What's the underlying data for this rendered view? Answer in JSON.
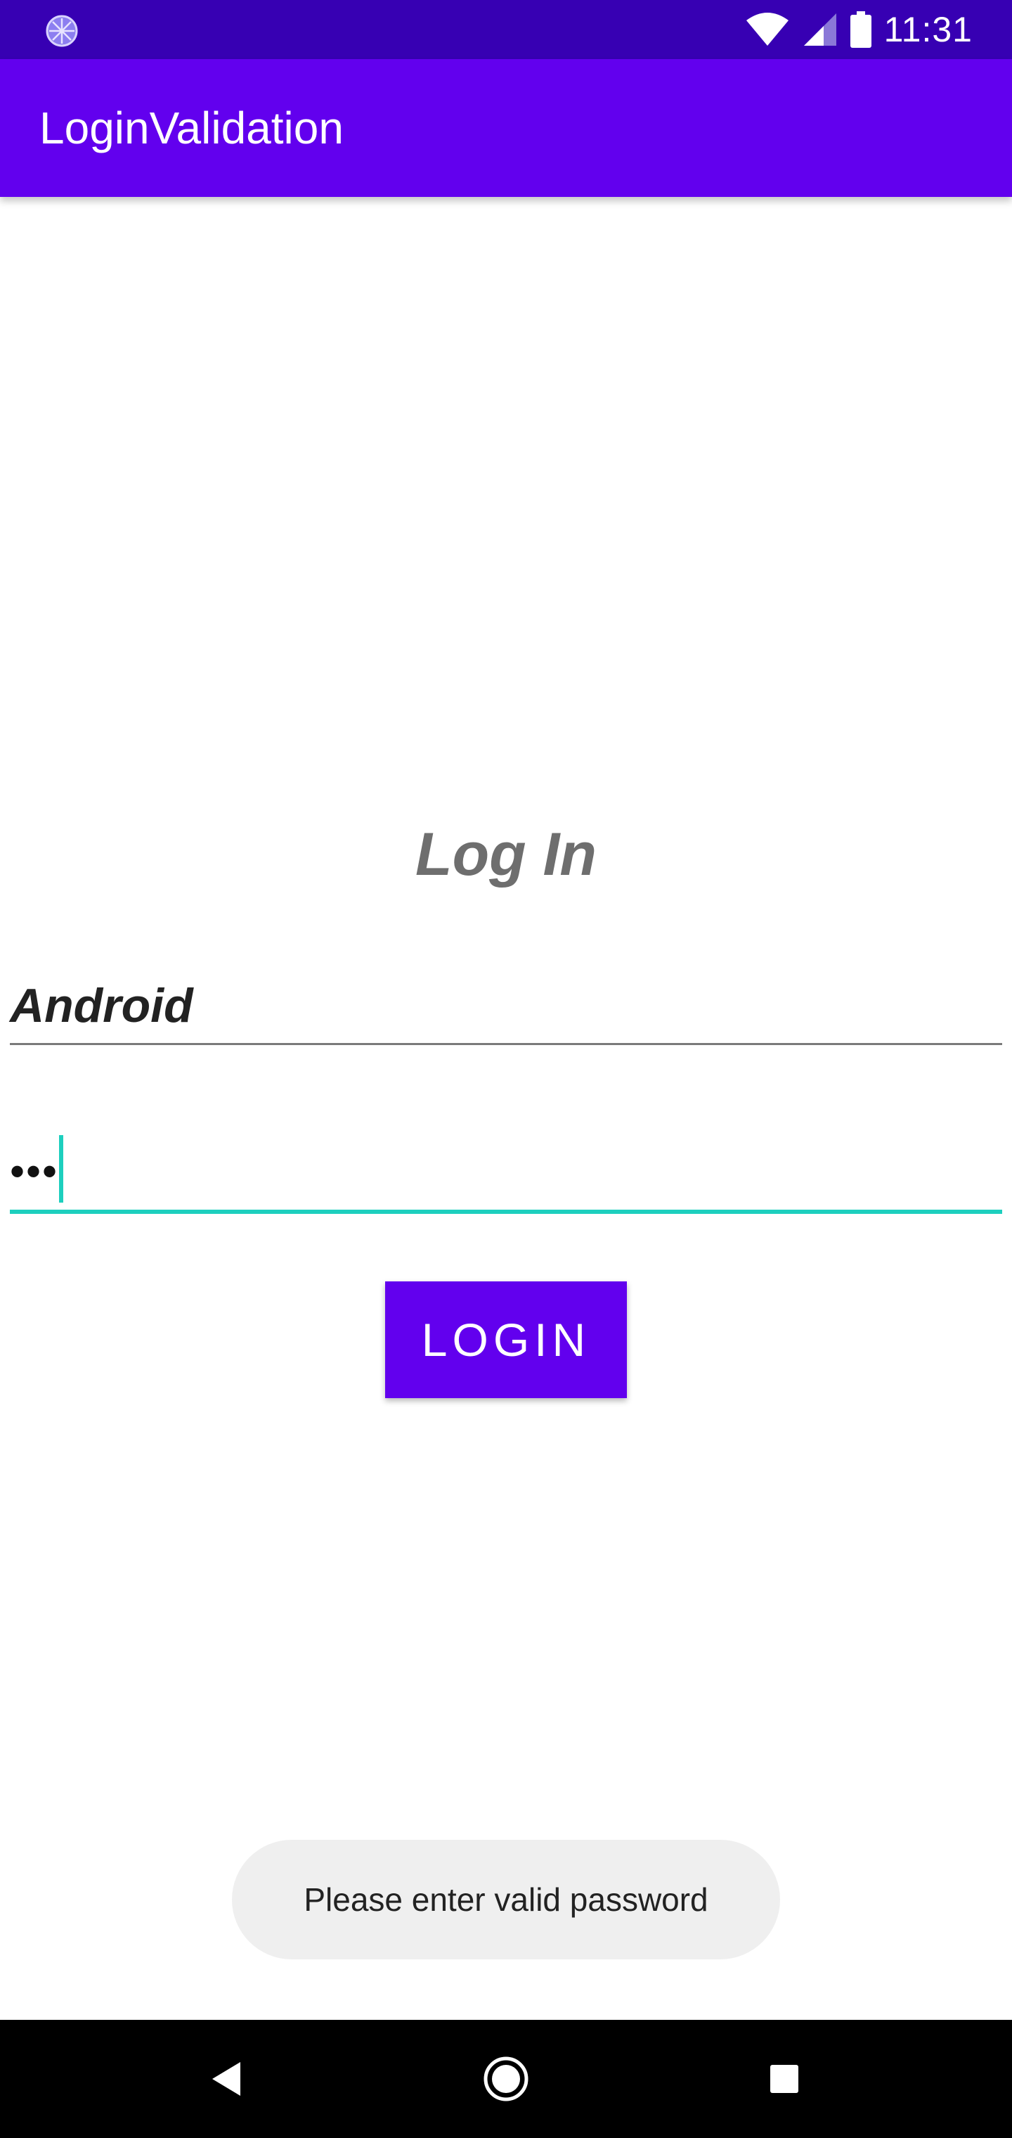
{
  "status_bar": {
    "time": "11:31",
    "icons": [
      "loading-spinner-icon",
      "wifi-icon",
      "cellular-signal-icon",
      "battery-icon"
    ]
  },
  "app_bar": {
    "title": "LoginValidation",
    "color": "#6200ee"
  },
  "login_form": {
    "heading": "Log In",
    "username_value": "Android",
    "password_value": "•••",
    "login_button_label": "LOGIN",
    "focused_field_accent": "#1dcfbe"
  },
  "toast": {
    "message": "Please enter valid password"
  },
  "nav_bar": {
    "icons": [
      "back-icon",
      "home-icon",
      "recents-icon"
    ]
  }
}
